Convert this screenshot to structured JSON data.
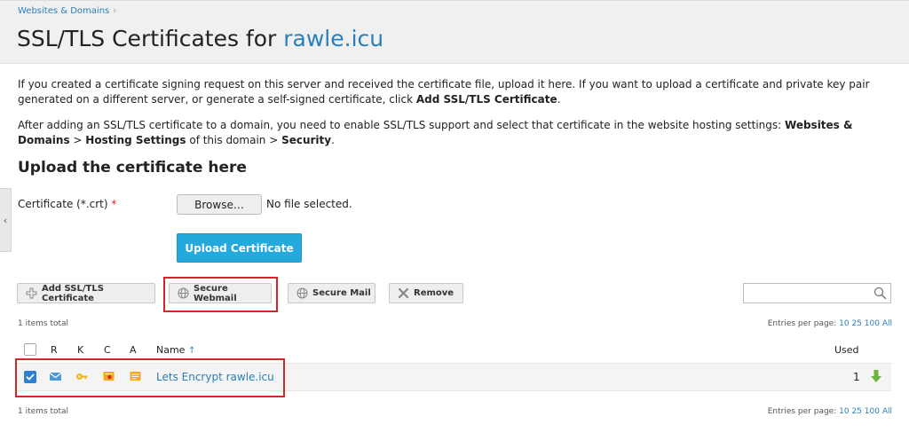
{
  "breadcrumb": {
    "link": "Websites & Domains",
    "separator": "›"
  },
  "header": {
    "title_prefix": "SSL/TLS Certificates for ",
    "domain": "rawle.icu"
  },
  "sidebar_toggle": {
    "glyph": "‹"
  },
  "intro": {
    "p1_a": "If you created a certificate signing request on this server and received the certificate file, upload it here. If you want to upload a certificate and private key pair generated on a different server, or generate a self-signed certificate, click ",
    "p1_b": "Add SSL/TLS Certificate",
    "p1_c": ".",
    "p2_a": "After adding an SSL/TLS certificate to a domain, you need to enable SSL/TLS support and select that certificate in the website hosting settings: ",
    "p2_b": "Websites & Domains",
    "p2_c": " > ",
    "p2_d": "Hosting Settings",
    "p2_e": " of this domain > ",
    "p2_f": "Security",
    "p2_g": "."
  },
  "upload": {
    "section_title": "Upload the certificate here",
    "field_label": "Certificate (*.crt)",
    "required_mark": "*",
    "browse_label": "Browse…",
    "file_status": "No file selected.",
    "submit_label": "Upload Certificate"
  },
  "toolbar": {
    "add_label": "Add SSL/TLS Certificate",
    "secure_webmail_label": "Secure Webmail",
    "secure_mail_label": "Secure Mail",
    "remove_label": "Remove",
    "search_placeholder": ""
  },
  "list": {
    "items_total": "1 items total",
    "entries_label": "Entries per page: ",
    "page_sizes": [
      "10",
      "25",
      "100",
      "All"
    ],
    "columns": {
      "r": "R",
      "k": "K",
      "c": "C",
      "a": "A",
      "name": "Name",
      "sort_arrow": "↑",
      "used": "Used"
    },
    "rows": [
      {
        "name": "Lets Encrypt rawle.icu",
        "used": "1",
        "checked": true
      }
    ]
  },
  "colors": {
    "accent": "#2a7fb8",
    "upload_button": "#23a9dc",
    "highlight": "#d9242b",
    "download_arrow": "#6db33f"
  }
}
